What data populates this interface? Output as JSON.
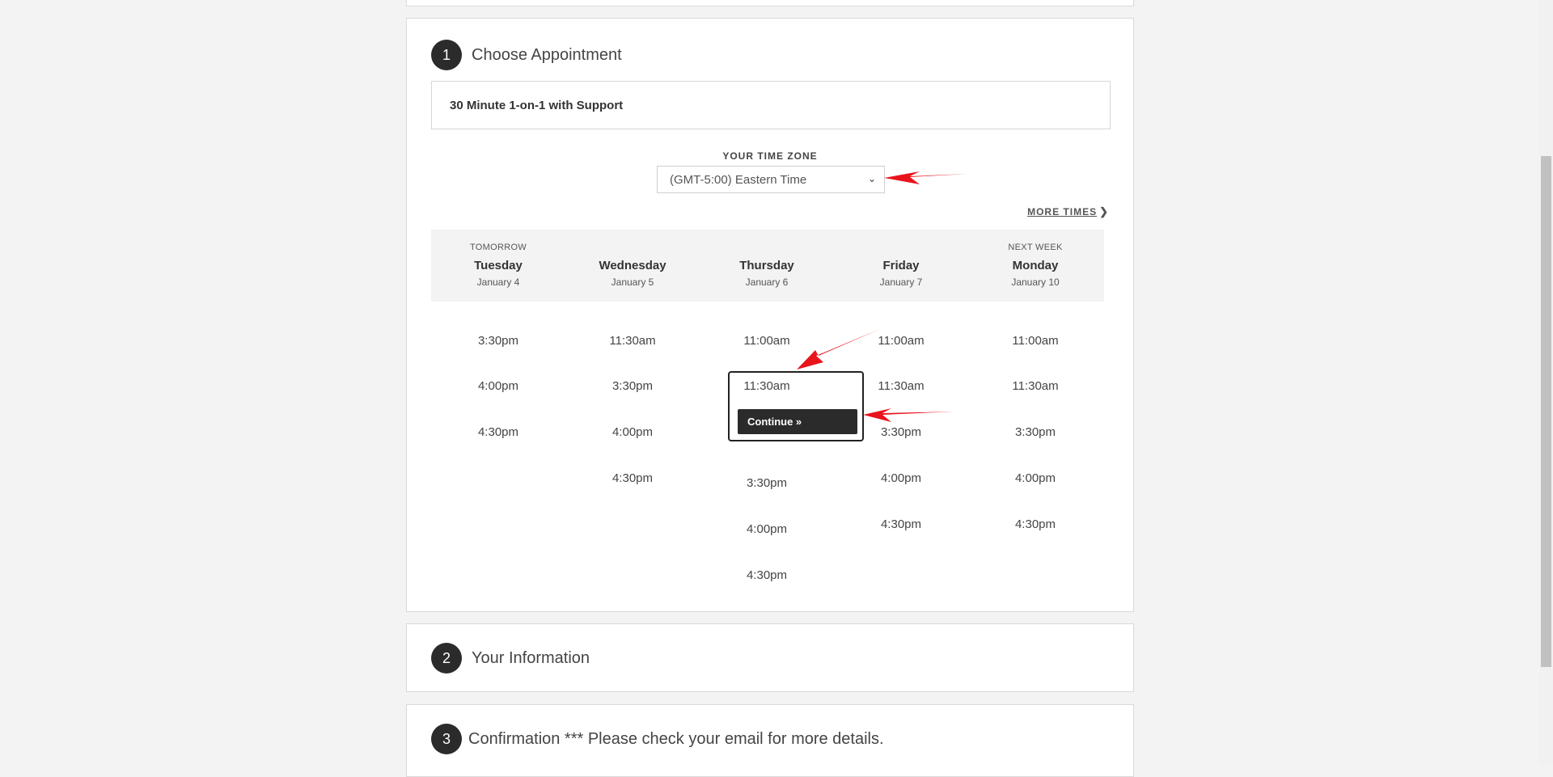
{
  "steps": {
    "choose": {
      "number": "1",
      "title": "Choose Appointment"
    },
    "info": {
      "number": "2",
      "title": "Your Information"
    },
    "confirm": {
      "number": "3",
      "title": "Confirmation *** Please check your email for more details."
    }
  },
  "appointment_type": "30 Minute 1-on-1 with Support",
  "timezone": {
    "label": "YOUR TIME ZONE",
    "selected": "(GMT-5:00) Eastern Time"
  },
  "more_times": "MORE TIMES",
  "days": [
    {
      "pre": "TOMORROW",
      "name": "Tuesday",
      "date": "January 4"
    },
    {
      "pre": "",
      "name": "Wednesday",
      "date": "January 5"
    },
    {
      "pre": "",
      "name": "Thursday",
      "date": "January 6"
    },
    {
      "pre": "",
      "name": "Friday",
      "date": "January 7"
    },
    {
      "pre": "NEXT WEEK",
      "name": "Monday",
      "date": "January 10"
    }
  ],
  "slots": [
    [
      "3:30pm",
      "4:00pm",
      "4:30pm"
    ],
    [
      "11:30am",
      "3:30pm",
      "4:00pm",
      "4:30pm"
    ],
    [
      "11:00am",
      "11:30am",
      "3:30pm",
      "4:00pm",
      "4:30pm"
    ],
    [
      "11:00am",
      "11:30am",
      "3:30pm",
      "4:00pm",
      "4:30pm"
    ],
    [
      "11:00am",
      "11:30am",
      "3:30pm",
      "4:00pm",
      "4:30pm"
    ]
  ],
  "continue_label": "Continue »",
  "colors": {
    "annotation_arrow": "#e8141c",
    "dark": "#2b2b2b"
  }
}
